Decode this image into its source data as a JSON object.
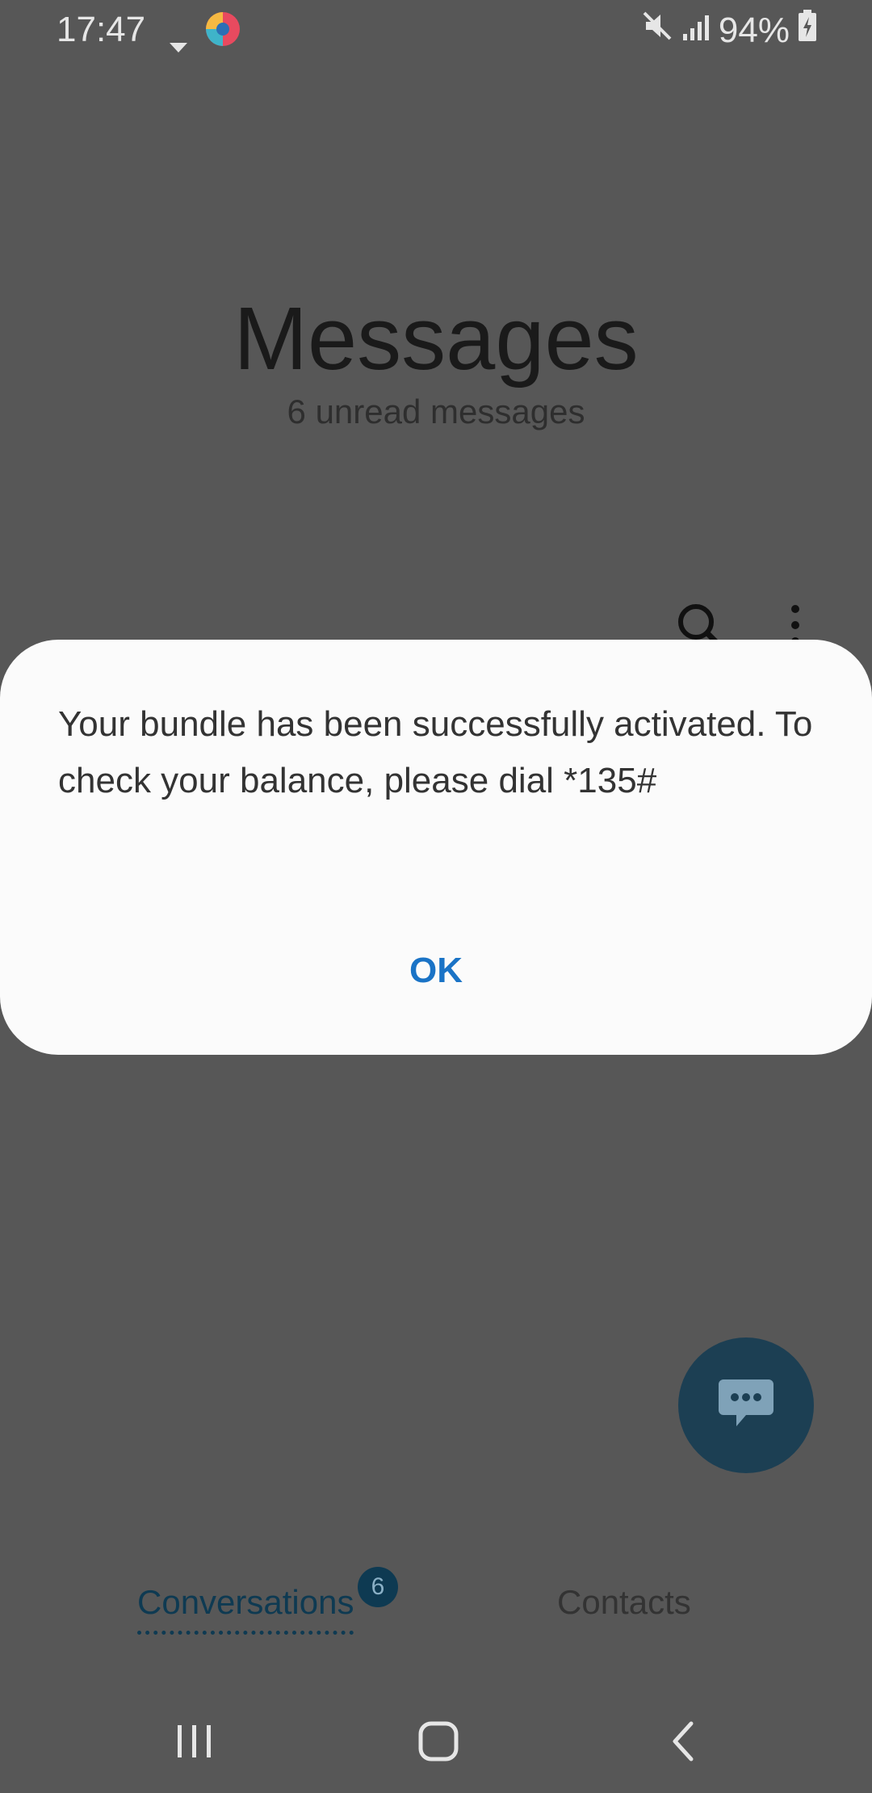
{
  "status_bar": {
    "time": "17:47",
    "battery": "94%",
    "icons": [
      "notification-arrow-icon",
      "browser-app-icon",
      "mute-icon",
      "signal-icon",
      "battery-charging-icon"
    ]
  },
  "header": {
    "title": "Messages",
    "subtitle": "6 unread messages"
  },
  "toolbar": {
    "icons": [
      "search-icon",
      "more-options-icon"
    ]
  },
  "dialog": {
    "message": "Your bundle has been successfully activated. To check your balance, please dial *135#",
    "ok_label": "OK"
  },
  "fab": {
    "icon": "compose-message-icon"
  },
  "tabs": {
    "conversations": {
      "label": "Conversations",
      "badge": "6"
    },
    "contacts": {
      "label": "Contacts"
    }
  },
  "nav_bar": {
    "icons": [
      "recents-icon",
      "home-icon",
      "back-icon"
    ]
  },
  "colors": {
    "accent": "#1a73c6",
    "fab": "#1c3f53",
    "tab_active": "#0e3a52",
    "scrim_background": "#575757"
  }
}
